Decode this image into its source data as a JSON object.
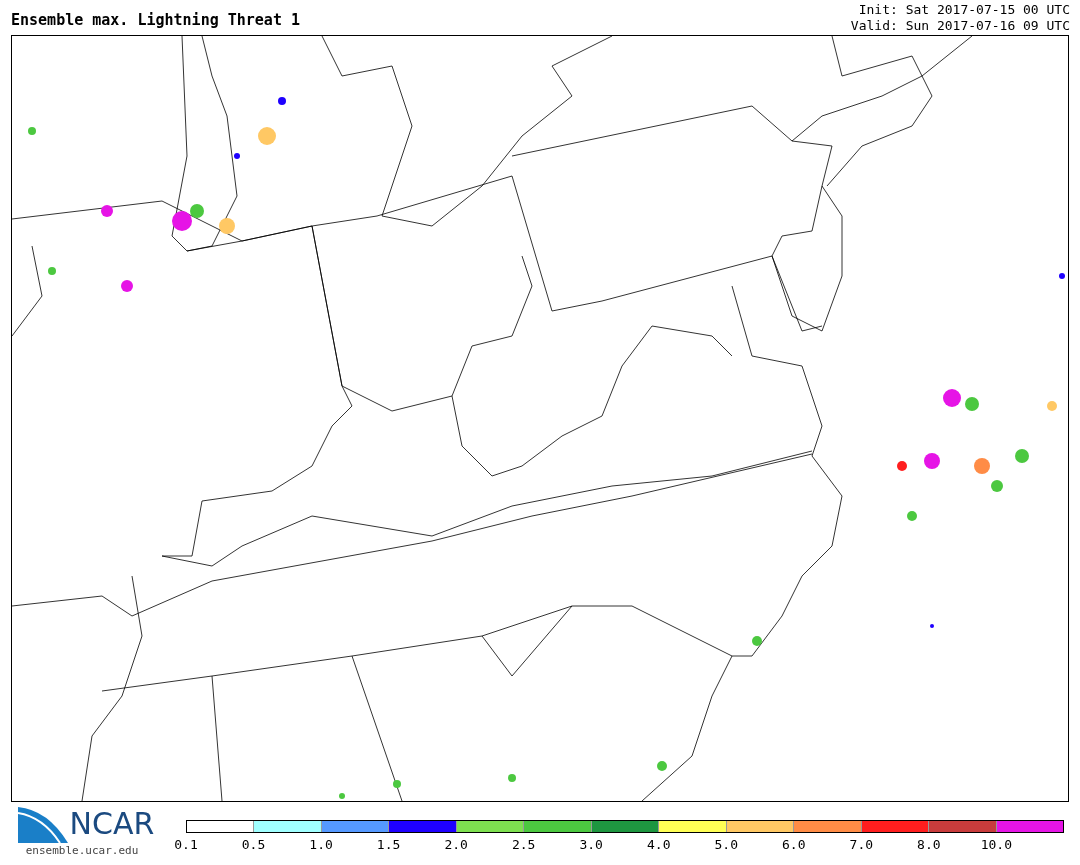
{
  "title": "Ensemble max. Lightning Threat 1",
  "init": "Init: Sat 2017-07-15 00 UTC",
  "valid": "Valid: Sun 2017-07-16 09 UTC",
  "logo": {
    "text": "NCAR",
    "url": "ensemble.ucar.edu"
  },
  "colorbar": {
    "segments": [
      {
        "color": "#ffffff"
      },
      {
        "color": "#a0ffff"
      },
      {
        "color": "#5599ff"
      },
      {
        "color": "#1e00ff"
      },
      {
        "color": "#7ee050"
      },
      {
        "color": "#4cc840"
      },
      {
        "color": "#1e9640"
      },
      {
        "color": "#ffff55"
      },
      {
        "color": "#ffc864"
      },
      {
        "color": "#ff8c46"
      },
      {
        "color": "#ff1e1e"
      },
      {
        "color": "#c83c3c"
      },
      {
        "color": "#e614e6"
      }
    ],
    "ticks": [
      "0.1",
      "0.5",
      "1.0",
      "1.5",
      "2.0",
      "2.5",
      "3.0",
      "4.0",
      "5.0",
      "6.0",
      "7.0",
      "8.0",
      "10.0"
    ]
  }
}
